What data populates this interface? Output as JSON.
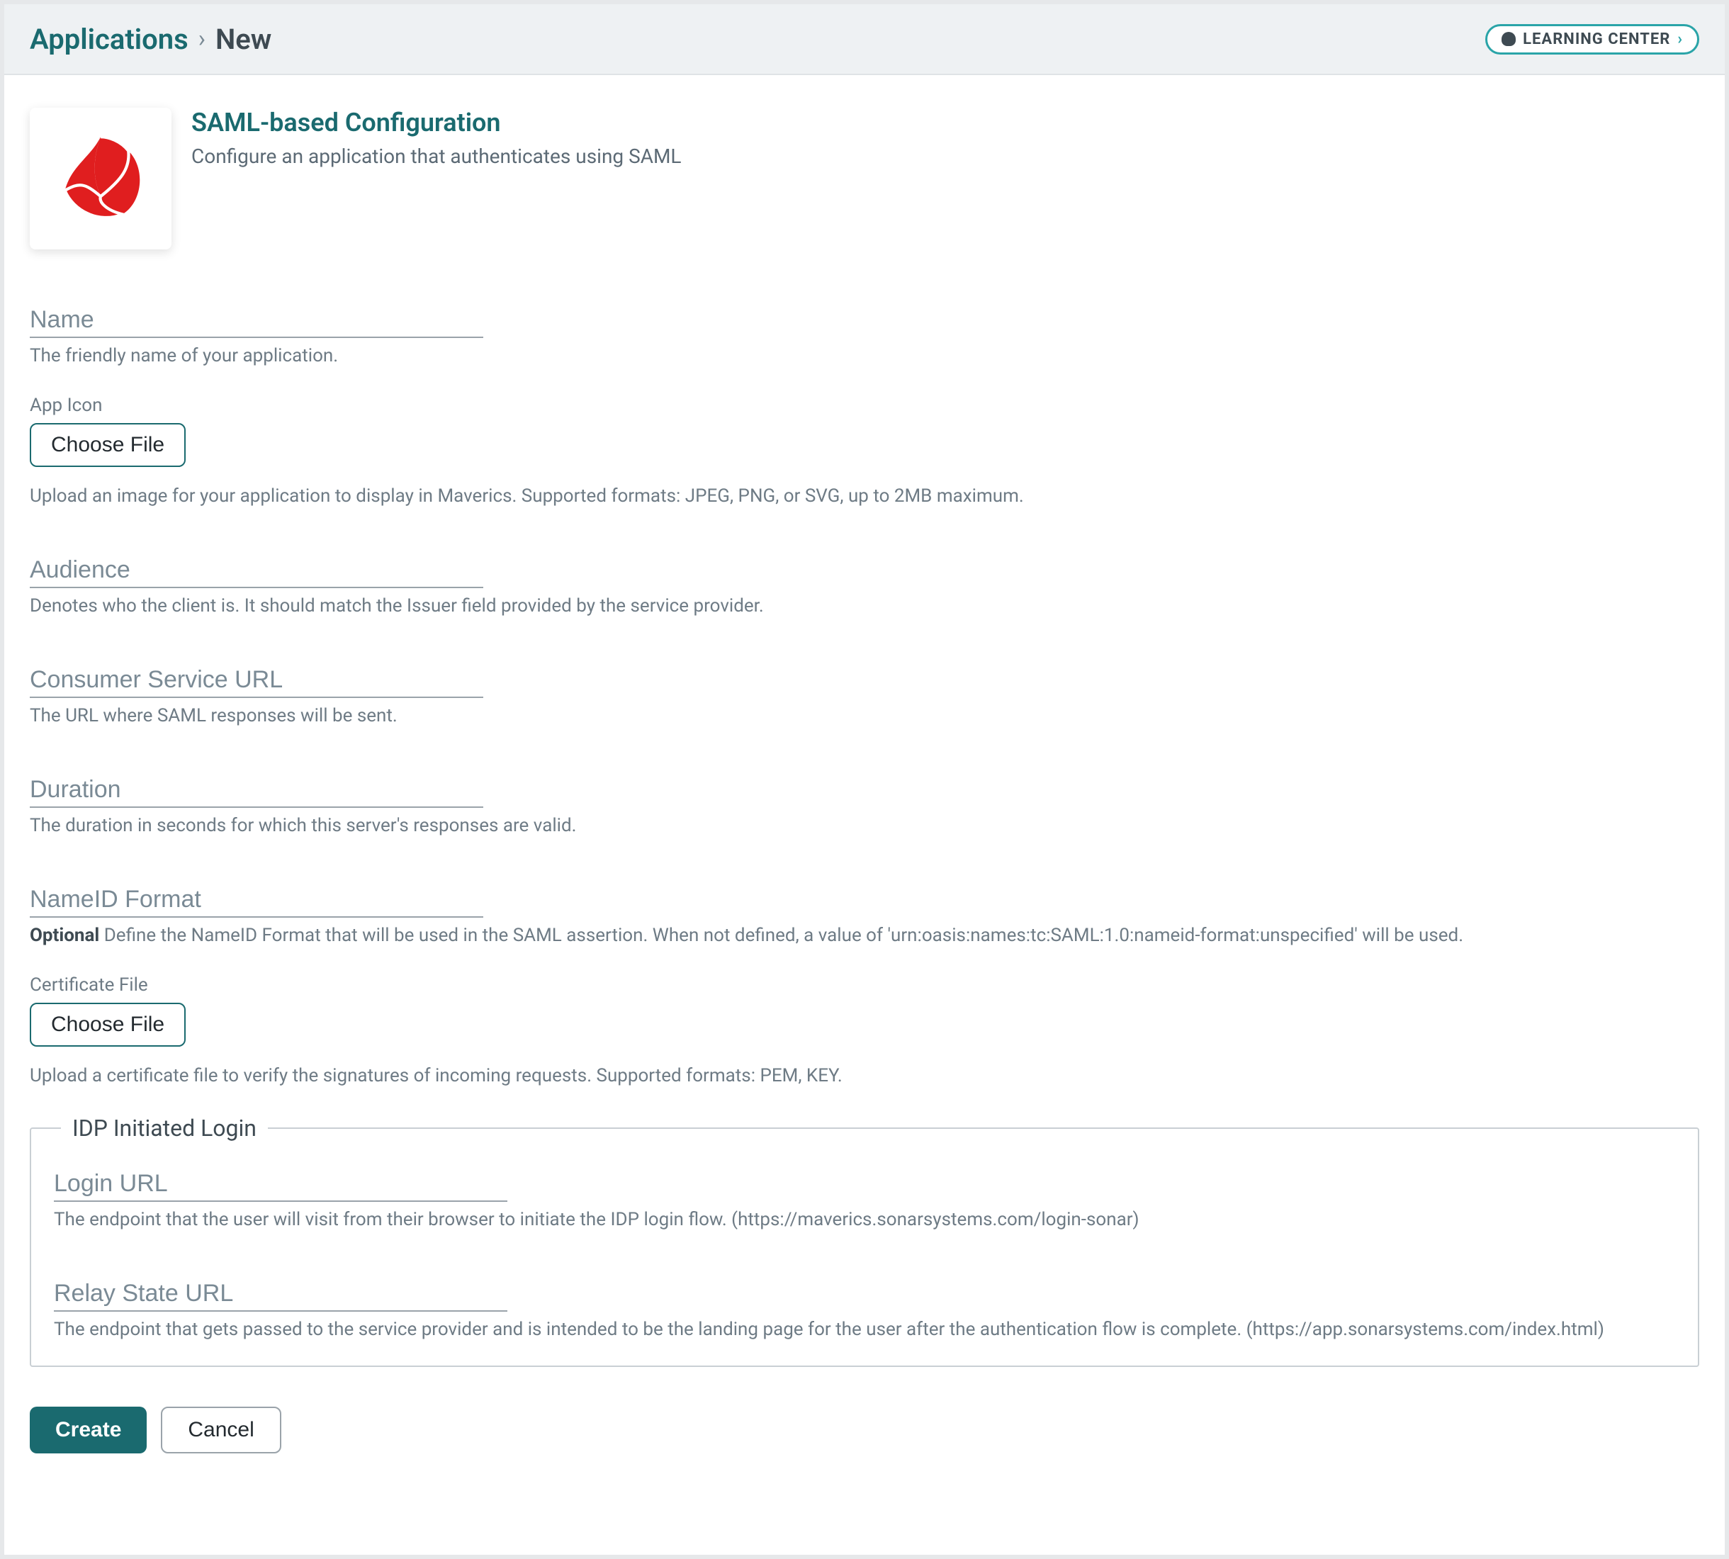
{
  "header": {
    "breadcrumb": {
      "root": "Applications",
      "current": "New"
    },
    "learning_center_label": "LEARNING CENTER"
  },
  "intro": {
    "title": "SAML-based Configuration",
    "description": "Configure an application that authenticates using SAML"
  },
  "fields": {
    "name": {
      "placeholder": "Name",
      "help": "The friendly name of your application."
    },
    "app_icon": {
      "label": "App Icon",
      "button": "Choose File",
      "help": "Upload an image for your application to display in Maverics. Supported formats: JPEG, PNG, or SVG, up to 2MB maximum."
    },
    "audience": {
      "placeholder": "Audience",
      "help": "Denotes who the client is. It should match the Issuer field provided by the service provider."
    },
    "consumer_url": {
      "placeholder": "Consumer Service URL",
      "help": "The URL where SAML responses will be sent."
    },
    "duration": {
      "placeholder": "Duration",
      "help": "The duration in seconds for which this server's responses are valid."
    },
    "nameid": {
      "placeholder": "NameID Format",
      "optional": "Optional",
      "help": "Define the NameID Format that will be used in the SAML assertion. When not defined, a value of 'urn:oasis:names:tc:SAML:1.0:nameid-format:unspecified' will be used."
    },
    "cert_file": {
      "label": "Certificate File",
      "button": "Choose File",
      "help": "Upload a certificate file to verify the signatures of incoming requests. Supported formats: PEM, KEY."
    },
    "idp": {
      "legend": "IDP Initiated Login",
      "login_url": {
        "placeholder": "Login URL",
        "help": "The endpoint that the user will visit from their browser to initiate the IDP login flow. (https://maverics.sonarsystems.com/login-sonar)"
      },
      "relay_state": {
        "placeholder": "Relay State URL",
        "help": "The endpoint that gets passed to the service provider and is intended to be the landing page for the user after the authentication flow is complete. (https://app.sonarsystems.com/index.html)"
      }
    }
  },
  "actions": {
    "create": "Create",
    "cancel": "Cancel"
  }
}
